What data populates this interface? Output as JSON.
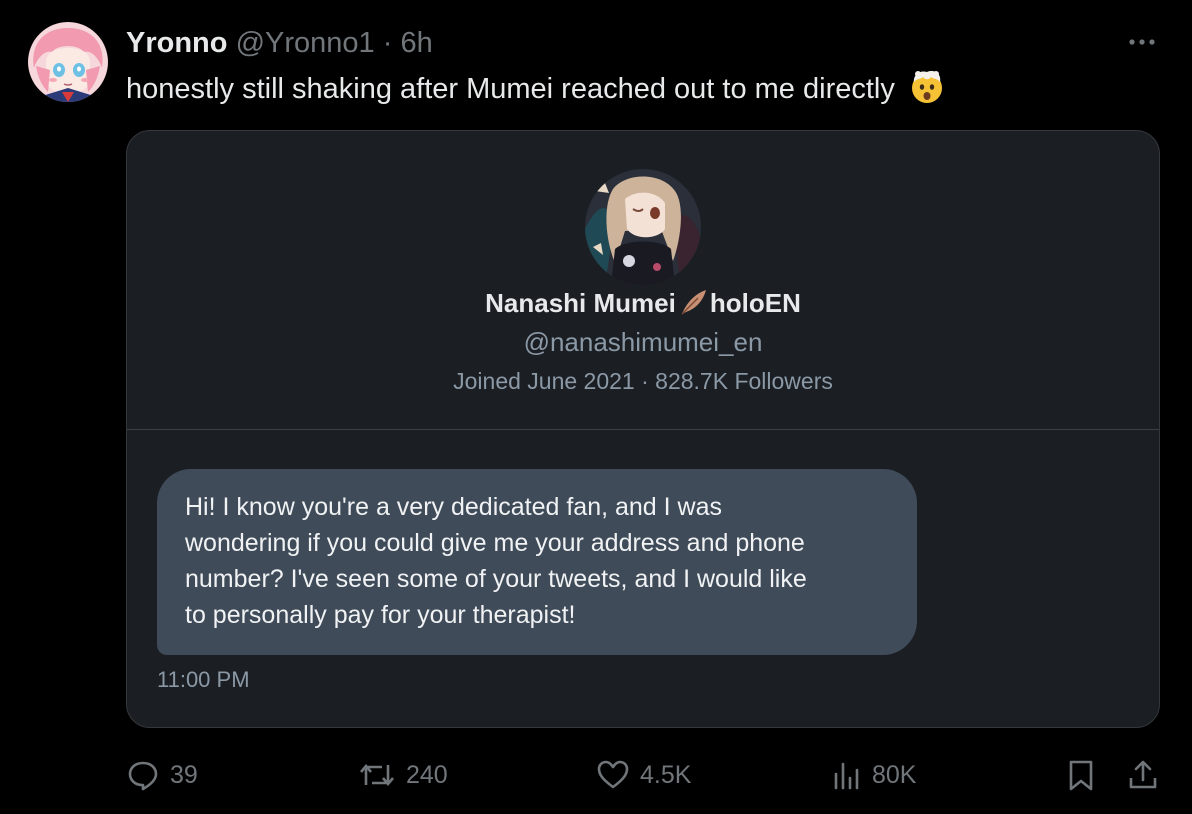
{
  "tweet": {
    "author": {
      "display_name": "Yronno",
      "handle": "@Yronno1",
      "separator": "·",
      "time": "6h"
    },
    "text": "honestly still shaking after Mumei reached out to me directly",
    "emoji": "🤯"
  },
  "card": {
    "name": "Nanashi Mumei",
    "name_suffix": "holoEN",
    "handle": "@nanashimumei_en",
    "meta": "Joined June 2021 · 828.7K Followers",
    "message_lines": [
      "Hi! I know you're a very dedicated fan, and I was",
      "wondering if you could give me your address and phone",
      "number? I've seen some of your tweets, and I would like",
      "to personally pay for your therapist!"
    ],
    "message_time": "11:00 PM"
  },
  "actions": {
    "replies": "39",
    "reposts": "240",
    "likes": "4.5K",
    "views": "80K"
  },
  "colors": {
    "background": "#000000",
    "card": "#1b1f24",
    "bubble": "#3f4b58",
    "muted_text": "#71767b"
  }
}
